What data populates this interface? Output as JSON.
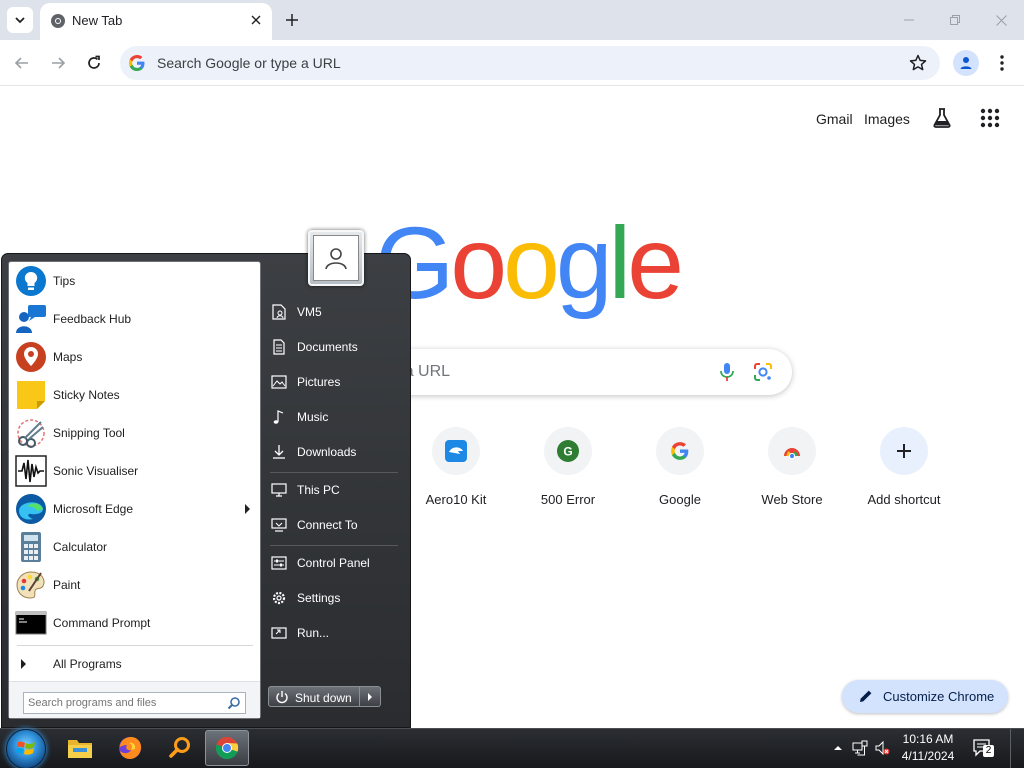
{
  "browser": {
    "tab_title": "New Tab",
    "omnibox_placeholder": "Search Google or type a URL"
  },
  "ntp": {
    "links": [
      "Gmail",
      "Images"
    ],
    "logo_letters": [
      {
        "char": "G",
        "color": "#4285f4"
      },
      {
        "char": "o",
        "color": "#ea4335"
      },
      {
        "char": "o",
        "color": "#fbbc05"
      },
      {
        "char": "g",
        "color": "#4285f4"
      },
      {
        "char": "l",
        "color": "#34a853"
      },
      {
        "char": "e",
        "color": "#ea4335"
      }
    ],
    "search_visible_text": "type a URL",
    "shortcuts": [
      {
        "label": "Aero10 Kit"
      },
      {
        "label": "500 Error",
        "letter": "G"
      },
      {
        "label": "Google"
      },
      {
        "label": "Web Store"
      },
      {
        "label": "Add shortcut"
      }
    ],
    "customize_label": "Customize Chrome"
  },
  "start_menu": {
    "programs": [
      {
        "label": "Tips",
        "icon": "tips-icon"
      },
      {
        "label": "Feedback Hub",
        "icon": "feedback-hub-icon"
      },
      {
        "label": "Maps",
        "icon": "maps-icon"
      },
      {
        "label": "Sticky Notes",
        "icon": "sticky-notes-icon"
      },
      {
        "label": "Snipping Tool",
        "icon": "snipping-tool-icon"
      },
      {
        "label": "Sonic Visualiser",
        "icon": "sonic-visualiser-icon"
      },
      {
        "label": "Microsoft Edge",
        "icon": "edge-icon",
        "submenu": true
      },
      {
        "label": "Calculator",
        "icon": "calculator-icon"
      },
      {
        "label": "Paint",
        "icon": "paint-icon"
      },
      {
        "label": "Command Prompt",
        "icon": "command-prompt-icon"
      }
    ],
    "all_programs": "All Programs",
    "search_placeholder": "Search programs and files",
    "places": [
      {
        "label": "VM5",
        "icon": "user-folder-icon"
      },
      {
        "label": "Documents",
        "icon": "documents-icon"
      },
      {
        "label": "Pictures",
        "icon": "pictures-icon"
      },
      {
        "label": "Music",
        "icon": "music-icon"
      },
      {
        "label": "Downloads",
        "icon": "downloads-icon"
      },
      {
        "label": "This PC",
        "icon": "computer-icon"
      },
      {
        "label": "Connect To",
        "icon": "connect-icon"
      },
      {
        "label": "Control Panel",
        "icon": "control-panel-icon"
      },
      {
        "label": "Settings",
        "icon": "settings-gear-icon"
      },
      {
        "label": "Run...",
        "icon": "run-icon"
      }
    ],
    "shutdown_label": "Shut down"
  },
  "taskbar": {
    "time": "10:16 AM",
    "date": "4/11/2024",
    "notification_count": "2"
  },
  "colors": {
    "tabstrip": "#dee3eb",
    "omnibox": "#edf2fa",
    "customize": "#d3e3fd",
    "taskbar": "#1f2226"
  }
}
